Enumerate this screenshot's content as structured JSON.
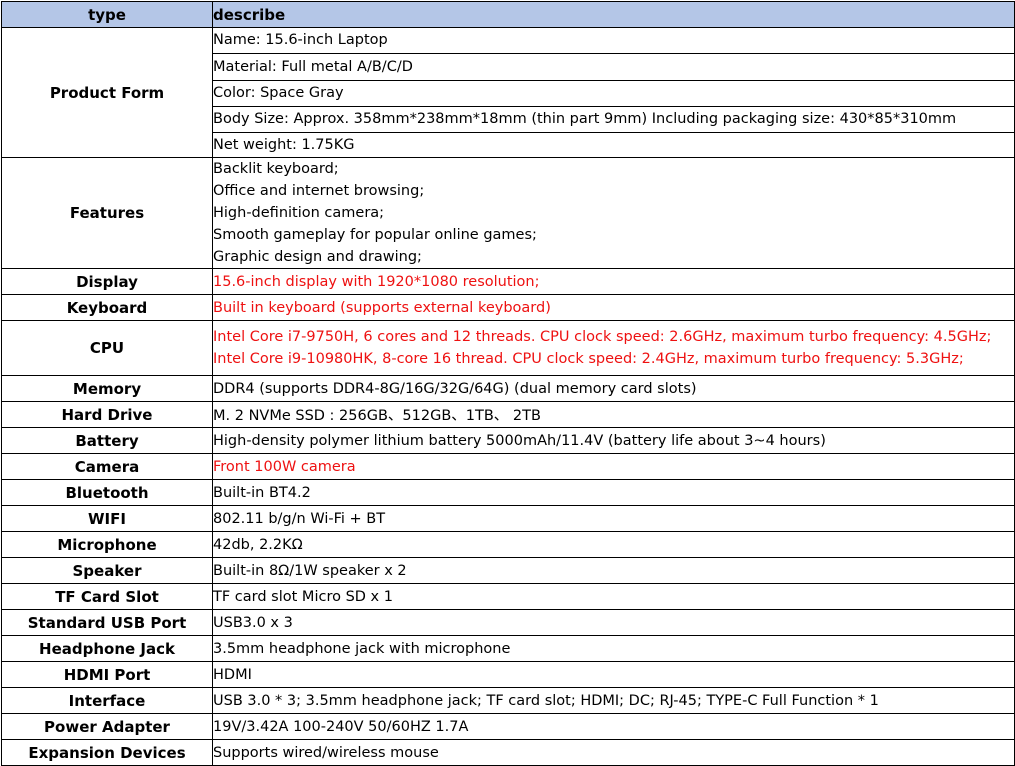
{
  "header": {
    "type": "type",
    "describe": "describe",
    "bg_color": "#b4c6e7"
  },
  "highlight_color": "#ee1111",
  "rows": [
    {
      "type": "Product Form",
      "lines": [
        "Name: 15.6-inch Laptop",
        "Material: Full metal A/B/C/D",
        "Color: Space Gray",
        "Body Size: Approx. 358mm*238mm*18mm (thin part 9mm) Including packaging size: 430*85*310mm",
        "Net weight: 1.75KG"
      ]
    },
    {
      "type": "Features",
      "lines": [
        "Backlit keyboard;",
        "Office and internet browsing;",
        "High-definition camera;",
        "Smooth gameplay for popular online games;",
        "Graphic design and drawing;"
      ]
    },
    {
      "type": "Display",
      "lines": [
        "15.6-inch display with 1920*1080 resolution;"
      ]
    },
    {
      "type": "Keyboard",
      "lines": [
        "Built in keyboard (supports external keyboard)"
      ]
    },
    {
      "type": "CPU",
      "lines": [
        "Intel Core i7-9750H, 6 cores and 12 threads. CPU clock speed: 2.6GHz, maximum turbo frequency: 4.5GHz;",
        "Intel Core i9-10980HK, 8-core 16 thread. CPU clock speed: 2.4GHz, maximum turbo frequency: 5.3GHz;"
      ]
    },
    {
      "type": "Memory",
      "lines": [
        "DDR4 (supports DDR4-8G/16G/32G/64G) (dual memory card slots)"
      ]
    },
    {
      "type": "Hard Drive",
      "lines": [
        "M. 2 NVMe SSD : 256GB、512GB、1TB、 2TB"
      ]
    },
    {
      "type": "Battery",
      "lines": [
        "High-density polymer lithium battery 5000mAh/11.4V (battery life about 3~4 hours)"
      ]
    },
    {
      "type": "Camera",
      "lines": [
        "Front 100W camera"
      ]
    },
    {
      "type": "Bluetooth",
      "lines": [
        "Built-in BT4.2"
      ]
    },
    {
      "type": "WIFI",
      "lines": [
        "802.11 b/g/n Wi-Fi + BT"
      ]
    },
    {
      "type": "Microphone",
      "lines": [
        "42db, 2.2KΩ"
      ]
    },
    {
      "type": "Speaker",
      "lines": [
        "Built-in 8Ω/1W speaker x 2"
      ]
    },
    {
      "type": "TF Card Slot",
      "lines": [
        "TF card slot Micro SD x 1"
      ]
    },
    {
      "type": "Standard USB Port",
      "lines": [
        "USB3.0 x 3"
      ]
    },
    {
      "type": "Headphone Jack",
      "lines": [
        "3.5mm headphone jack with microphone"
      ]
    },
    {
      "type": "HDMI Port",
      "lines": [
        "HDMI"
      ]
    },
    {
      "type": "Interface",
      "lines": [
        "USB 3.0 * 3; 3.5mm headphone jack; TF card slot; HDMI; DC; RJ-45;  TYPE-C Full Function * 1"
      ]
    },
    {
      "type": "Power Adapter",
      "lines": [
        "19V/3.42A 100-240V 50/60HZ 1.7A"
      ]
    },
    {
      "type": "Expansion Devices",
      "lines": [
        "Supports wired/wireless mouse"
      ]
    }
  ]
}
